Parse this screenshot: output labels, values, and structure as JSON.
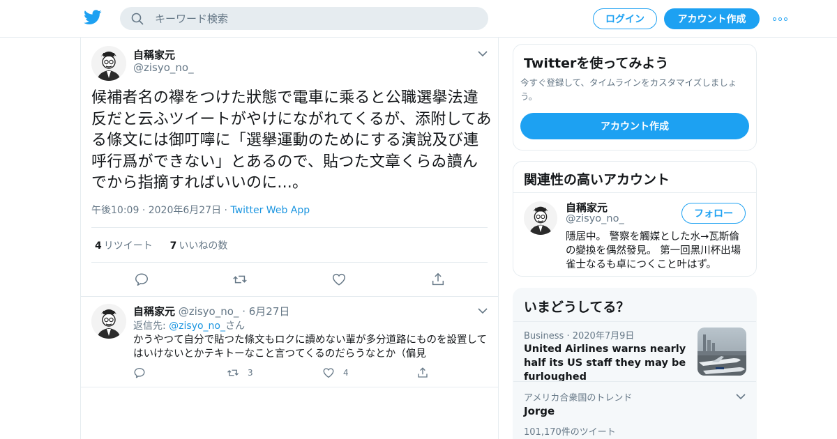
{
  "header": {
    "search_placeholder": "キーワード検索",
    "login_label": "ログイン",
    "signup_label": "アカウント作成",
    "brand_color": "#1da1f2"
  },
  "tweet": {
    "author_name": "自稱家元",
    "author_handle": "@zisyo_no_",
    "text": "候補者名の襷をつけた狀態で電車に乘ると公職選擧法違反だと云ふツイートがやけにながれてくるが、添附してある條文には御叮嚀に「選擧運動のためにする演說及び連呼行爲ができない」とあるので、貼つた文章くらゐ讀んでから指摘すればいいのに...。",
    "time": "午後10:09",
    "date": "2020年6月27日",
    "source": "Twitter Web App",
    "retweet_count": "4",
    "retweet_label": "リツイート",
    "like_count": "7",
    "like_label": "いいねの数"
  },
  "reply": {
    "author_name": "自稱家元",
    "author_handle": "@zisyo_no_",
    "date": "6月27日",
    "reply_prefix": "返信先: ",
    "reply_to": "@zisyo_no_",
    "reply_suffix": "さん",
    "text": "かうやつて自分で貼つた條文もロクに讀めない輩が多分道路にものを設置してはいけないとかテキトーなこと言つてくるのだらうなとか（偏見",
    "retweet_count": "3",
    "like_count": "4"
  },
  "sidebar": {
    "signup_card": {
      "title": "Twitterを使ってみよう",
      "description": "今すぐ登録して、タイムラインをカスタマイズしましょう。",
      "button_label": "アカウント作成"
    },
    "related_card": {
      "title": "関連性の高いアカウント",
      "name": "自稱家元",
      "handle": "@zisyo_no_",
      "follow_label": "フォロー",
      "bio": "隱居中。 警察を觸媒とした水→瓦斯倫の變換を偶然發見。 第一回黑川杯出場雀士なるも卓につくこと叶はず。"
    },
    "trends_card": {
      "title": "いまどうしてる？",
      "items": [
        {
          "category": "Business",
          "date": "2020年7月9日",
          "headline": "United Airlines warns nearly half its US staff they may be furloughed"
        },
        {
          "category": "アメリカ合衆国のトレンド",
          "name": "Jorge",
          "count": "101,170件のツイート"
        }
      ]
    }
  }
}
